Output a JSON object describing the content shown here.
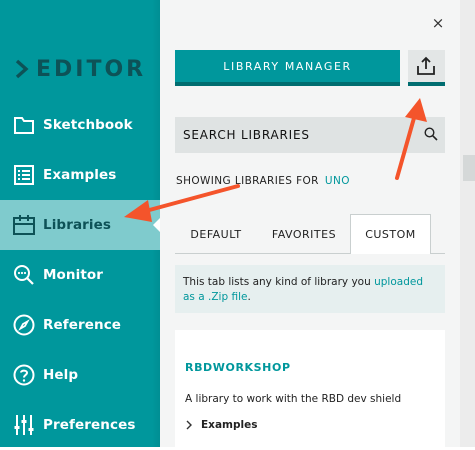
{
  "sidebar": {
    "brand": "EDITOR",
    "items": [
      {
        "label": "Sketchbook",
        "icon": "folder-icon"
      },
      {
        "label": "Examples",
        "icon": "list-icon"
      },
      {
        "label": "Libraries",
        "icon": "libraries-icon",
        "active": true
      },
      {
        "label": "Monitor",
        "icon": "monitor-icon"
      },
      {
        "label": "Reference",
        "icon": "compass-icon"
      },
      {
        "label": "Help",
        "icon": "help-icon"
      },
      {
        "label": "Preferences",
        "icon": "sliders-icon"
      }
    ]
  },
  "panel": {
    "close": "×",
    "library_manager_label": "LIBRARY MANAGER",
    "search": {
      "placeholder": "SEARCH LIBRARIES"
    },
    "showing": {
      "text": "SHOWING LIBRARIES FOR",
      "board": "UNO"
    },
    "tabs": [
      {
        "label": "DEFAULT"
      },
      {
        "label": "FAVORITES"
      },
      {
        "label": "CUSTOM",
        "active": true
      }
    ],
    "info": {
      "text": "This tab lists any kind of library you",
      "link": "uploaded as a .Zip file",
      "end": "."
    },
    "library": {
      "name": "RBDWORKSHOP",
      "description": "A library to work with the RBD dev shield",
      "examples_label": "Examples"
    }
  },
  "colors": {
    "teal": "#00979c",
    "teal_dark": "#006d70",
    "active_bg": "#7fcbcd",
    "arrow": "#f4542b"
  }
}
